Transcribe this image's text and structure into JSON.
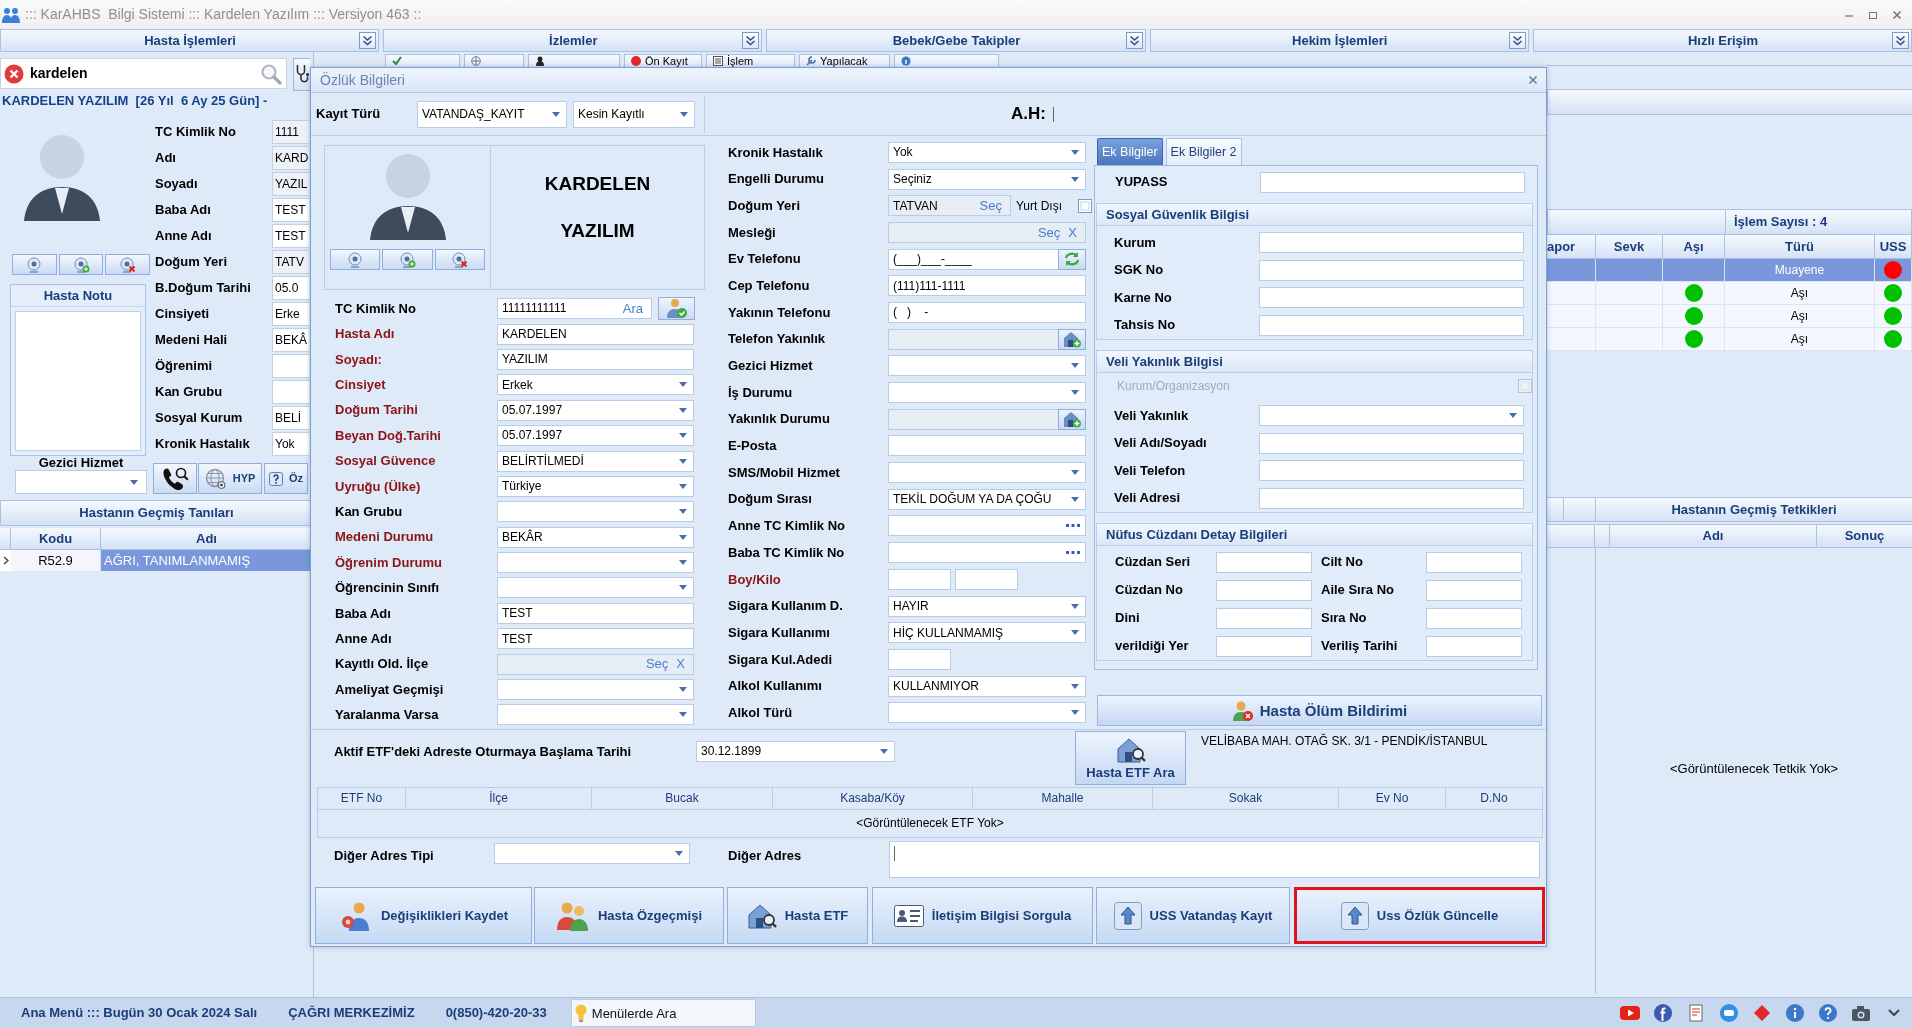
{
  "window": {
    "title": "::: KarAHBS  Bilgi Sistemi ::: Kardelen Yazılım ::: Versiyon 463 ::"
  },
  "menu_panels": [
    {
      "label": "Hasta İşlemleri"
    },
    {
      "label": "İzlemler"
    },
    {
      "label": "Bebek/Gebe Takipler"
    },
    {
      "label": "Hekim İşlemleri"
    },
    {
      "label": "Hızlı Erişim"
    }
  ],
  "patient_search": {
    "value": "kardelen"
  },
  "patient_banner": "KARDELEN YAZILIM  [26 Yıl  6 Ay 25 Gün] -",
  "patient_summary": [
    {
      "label": "TC Kimlik No",
      "value": "1111",
      "readonly": true
    },
    {
      "label": "Adı",
      "value": "KARD",
      "readonly": true
    },
    {
      "label": "Soyadı",
      "value": "YAZIL",
      "readonly": true
    },
    {
      "label": "Baba Adı",
      "value": "TEST",
      "readonly": false
    },
    {
      "label": "Anne Adı",
      "value": "TEST",
      "readonly": false
    },
    {
      "label": "Doğum Yeri",
      "value": "TATV",
      "readonly": true
    },
    {
      "label": "B.Doğum Tarihi",
      "value": "05.0",
      "readonly": false
    },
    {
      "label": "Cinsiyeti",
      "value": "Erke",
      "readonly": false
    },
    {
      "label": "Medeni Hali",
      "value": "BEKÂ",
      "readonly": false
    },
    {
      "label": "Öğrenimi",
      "readonly": false
    },
    {
      "label": "Kan Grubu",
      "readonly": false
    },
    {
      "label": "Sosyal Kurum",
      "value": "BELİ",
      "readonly": false
    },
    {
      "label": "Kronik Hastalık",
      "value": "Yok",
      "readonly": false
    }
  ],
  "patient_note": {
    "title": "Hasta Notu"
  },
  "mobile_service": {
    "label": "Gezici Hizmet"
  },
  "quick_buttons": [
    {
      "label": "HYP"
    },
    {
      "label": "Öz"
    }
  ],
  "past_diagnoses": {
    "title": "Hastanın Geçmiş Tanıları",
    "columns": [
      "Kodu",
      "Adı"
    ],
    "rows": [
      {
        "code": "R52.9",
        "name": "AĞRI, TANIMLANMAMIŞ",
        "selected": true
      }
    ]
  },
  "toolbar": [
    {
      "label": "Ön Kayıt"
    },
    {
      "label": "İşlem"
    },
    {
      "label": "Yapılacak"
    }
  ],
  "dialog": {
    "title": "Özlük Bilgileri",
    "record_type": {
      "label": "Kayıt Türü",
      "type_value": "VATANDAŞ_KAYIT",
      "status_value": "Kesin Kayıtlı"
    },
    "ah_label": "A.H:",
    "patient_name": [
      "KARDELEN",
      "YAZILIM"
    ],
    "left_fields": [
      {
        "kind": "search",
        "label": "TC Kimlik No",
        "required": false,
        "value": "11111111111",
        "action": "Ara"
      },
      {
        "kind": "text",
        "label": "Hasta Adı",
        "required": true,
        "value": "KARDELEN"
      },
      {
        "kind": "text",
        "label": "Soyadı:",
        "required": true,
        "value": "YAZILIM"
      },
      {
        "kind": "select",
        "label": "Cinsiyet",
        "required": true,
        "value": "Erkek"
      },
      {
        "kind": "select",
        "label": "Doğum Tarihi",
        "required": true,
        "value": "05.07.1997"
      },
      {
        "kind": "select",
        "label": "Beyan Doğ.Tarihi",
        "required": true,
        "value": "05.07.1997"
      },
      {
        "kind": "select",
        "label": "Sosyal Güvence",
        "required": true,
        "value": "BELİRTİLMEDİ"
      },
      {
        "kind": "select",
        "label": "Uyruğu (Ülke)",
        "required": true,
        "value": "Türkiye"
      },
      {
        "kind": "select",
        "label": "Kan Grubu",
        "required": false
      },
      {
        "kind": "select",
        "label": "Medeni Durumu",
        "required": true,
        "value": "BEKÂR"
      },
      {
        "kind": "select",
        "label": "Öğrenim Durumu",
        "required": true
      },
      {
        "kind": "select",
        "label": "Öğrencinin Sınıfı",
        "required": false
      },
      {
        "kind": "text",
        "label": "Baba Adı",
        "required": false,
        "value": "TEST"
      },
      {
        "kind": "text",
        "label": "Anne Adı",
        "required": false,
        "value": "TEST"
      },
      {
        "kind": "picker",
        "label": "Kayıtlı Old. İlçe",
        "required": false,
        "action": "Seç",
        "clear": "X"
      },
      {
        "kind": "select",
        "label": "Ameliyat Geçmişi",
        "required": false
      },
      {
        "kind": "select",
        "label": "Yaralanma Varsa",
        "required": false
      }
    ],
    "middle_fields": [
      {
        "kind": "select",
        "label": "Kronik Hastalık",
        "required": false,
        "value": "Yok"
      },
      {
        "kind": "select",
        "label": "Engelli Durumu",
        "required": false,
        "value": "Seçiniz"
      },
      {
        "kind": "picker",
        "label": "Doğum Yeri",
        "required": false,
        "value": "TATVAN",
        "action": "Seç",
        "option": {
          "label": "Yurt Dışı",
          "checked": false
        }
      },
      {
        "kind": "picker",
        "label": "Mesleği",
        "required": false,
        "action": "Seç",
        "clear": "X"
      },
      {
        "kind": "refresh",
        "label": "Ev Telefonu",
        "required": false,
        "value": "(___)___-____"
      },
      {
        "kind": "text",
        "label": "Cep Telefonu",
        "required": false,
        "value": "(111)111-1111"
      },
      {
        "kind": "text",
        "label": "Yakının Telefonu",
        "required": false,
        "value": "(   )    -"
      },
      {
        "kind": "lookup",
        "label": "Telefon Yakınlık",
        "required": false
      },
      {
        "kind": "select",
        "label": "Gezici Hizmet",
        "required": false
      },
      {
        "kind": "select",
        "label": "İş Durumu",
        "required": false
      },
      {
        "kind": "lookup",
        "label": "Yakınlık Durumu",
        "required": false
      },
      {
        "kind": "text",
        "label": "E-Posta",
        "required": false
      },
      {
        "kind": "select",
        "label": "SMS/Mobil Hizmet",
        "required": false
      },
      {
        "kind": "select",
        "label": "Doğum Sırası",
        "required": false,
        "value": "TEKİL DOĞUM YA DA ÇOĞU"
      },
      {
        "kind": "ellipsis",
        "label": "Anne TC Kimlik No",
        "required": false
      },
      {
        "kind": "ellipsis",
        "label": "Baba TC Kimlik No",
        "required": false
      },
      {
        "kind": "pair",
        "label": "Boy/Kilo",
        "required": true
      },
      {
        "kind": "select",
        "label": "Sigara Kullanım D.",
        "required": false,
        "value": "HAYIR"
      },
      {
        "kind": "select",
        "label": "Sigara Kullanımı",
        "required": false,
        "value": "HİÇ KULLANMAMIŞ"
      },
      {
        "kind": "short",
        "label": "Sigara Kul.Adedi",
        "required": false
      },
      {
        "kind": "select",
        "label": "Alkol Kullanımı",
        "required": false,
        "value": "KULLANMIYOR"
      },
      {
        "kind": "select",
        "label": "Alkol Türü",
        "required": false
      }
    ],
    "tabs": [
      {
        "label": "Ek Bilgiler",
        "selected": true
      },
      {
        "label": "Ek Bilgiler 2",
        "selected": false
      }
    ],
    "tab_fields": [
      {
        "kind": "text",
        "label": "YUPASS"
      }
    ],
    "groups": [
      {
        "title": "Sosyal Güvenlik Bilgisi",
        "kind": "list",
        "fields": [
          {
            "kind": "text",
            "label": "Kurum"
          },
          {
            "kind": "text",
            "label": "SGK No"
          },
          {
            "kind": "text",
            "label": "Karne No"
          },
          {
            "kind": "text",
            "label": "Tahsis No"
          }
        ]
      },
      {
        "title": "Veli Yakınlık Bilgisi",
        "kind": "list",
        "checkbox": {
          "label": "Kurum/Organizasyon",
          "checked": false,
          "disabled": true
        },
        "fields": [
          {
            "kind": "select",
            "label": "Veli Yakınlık"
          },
          {
            "kind": "text",
            "label": "Veli Adı/Soyadı"
          },
          {
            "kind": "text",
            "label": "Veli Telefon"
          },
          {
            "kind": "text",
            "label": "Veli Adresi"
          }
        ]
      },
      {
        "title": "Nüfus Cüzdanı Detay Bilgileri",
        "kind": "grid",
        "fields": [
          {
            "kind": "text",
            "label": "Cüzdan Seri"
          },
          {
            "kind": "text",
            "label": "Cilt No"
          },
          {
            "kind": "text",
            "label": "Cüzdan No"
          },
          {
            "kind": "text",
            "label": "Aile Sıra No"
          },
          {
            "kind": "text",
            "label": "Dini"
          },
          {
            "kind": "text",
            "label": "Sıra No"
          },
          {
            "kind": "text",
            "label": "verildiği Yer"
          },
          {
            "kind": "text",
            "label": "Veriliş Tarihi"
          }
        ]
      }
    ],
    "death_button": "Hasta Ölüm Bildirimi",
    "etf_date": {
      "label": "Aktif ETF'deki Adreste Oturmaya Başlama Tarihi",
      "value": "30.12.1899"
    },
    "etf_search_button": "Hasta ETF Ara",
    "etf_address": "VELİBABA MAH. OTAĞ SK. 3/1 - PENDİK/İSTANBUL",
    "etf_table": {
      "columns": [
        "ETF No",
        "İlçe",
        "Bucak",
        "Kasaba/Köy",
        "Mahalle",
        "Sokak",
        "Ev No",
        "D.No"
      ],
      "empty_text": "<Görüntülenecek ETF Yok>"
    },
    "other_address_type": {
      "label": "Diğer Adres Tipi"
    },
    "other_address": {
      "label": "Diğer Adres"
    },
    "buttons": [
      {
        "label": "Değişiklikleri Kaydet",
        "highlighted": false
      },
      {
        "label": "Hasta Özgeçmişi",
        "highlighted": false
      },
      {
        "label": "Hasta ETF",
        "highlighted": false
      },
      {
        "label": "İletişim Bilgisi Sorgula",
        "highlighted": false
      },
      {
        "label": "USS Vatandaş Kayıt",
        "highlighted": false
      },
      {
        "label": "Uss Özlük Güncelle",
        "highlighted": true
      }
    ]
  },
  "visits": {
    "count_label": "İşlem Sayısı : 4",
    "columns": [
      "apor",
      "Sevk",
      "Aşı",
      "Türü",
      "USS"
    ],
    "rows": [
      {
        "type": "Muayene",
        "uss": {
          "color": "#ff0000"
        },
        "selected": true
      },
      {
        "type": "Aşı",
        "asi": {
          "color": "#00c000"
        },
        "uss": {
          "color": "#00c000"
        },
        "selected": false
      },
      {
        "type": "Aşı",
        "asi": {
          "color": "#00c000"
        },
        "uss": {
          "color": "#00c000"
        },
        "selected": false
      },
      {
        "type": "Aşı",
        "asi": {
          "color": "#00c000"
        },
        "uss": {
          "color": "#00c000"
        },
        "selected": false
      }
    ]
  },
  "past_tests": {
    "title": "Hastanın Geçmiş Tetkikleri",
    "columns": [
      "Adı",
      "Sonuç"
    ],
    "empty_text": "<Görüntülenecek Tetkik Yok>"
  },
  "status_bar": {
    "date_text": "Ana Menü ::: Bugün 30 Ocak 2024 Salı",
    "call_center": "ÇAĞRI MERKEZİMİZ",
    "phone": "0(850)-420-20-33",
    "menu_search": {
      "placeholder": "Menülerde Ara"
    }
  }
}
